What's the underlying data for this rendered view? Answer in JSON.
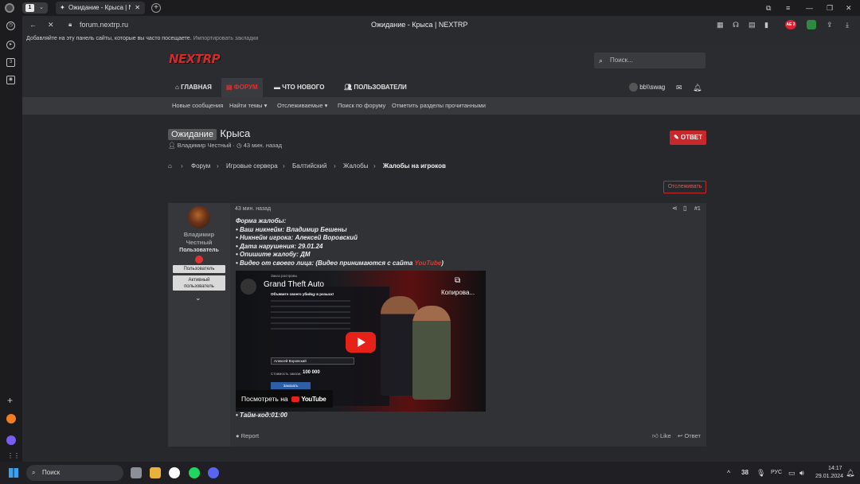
{
  "browser": {
    "tab_count": "1",
    "tab_title": "Ожидание - Крыса | NEXTRP",
    "address": "forum.nextrp.ru",
    "window_title": "Ожидание - Крыса | NEXTRP",
    "bookmarks_text": "Добавляйте на эту панель сайты, которые вы часто посещаете.",
    "bookmarks_link": "Импортировать закладки",
    "badge_ae": "AE 2"
  },
  "site": {
    "logo": "NEXTRP",
    "search_placeholder": "Поиск...",
    "nav": [
      {
        "label": "ГЛАВНАЯ"
      },
      {
        "label": "ФОРУМ"
      },
      {
        "label": "ЧТО НОВОГО"
      },
      {
        "label": "ПОЛЬЗОВАТЕЛИ"
      }
    ],
    "username": "bb\\\\swag",
    "subnav": [
      "Новые сообщения",
      "Найти темы",
      "Отслеживаемые",
      "Поиск по форуму",
      "Отметить разделы прочитанными"
    ]
  },
  "thread": {
    "prefix": "Ожидание",
    "title": "Крыса",
    "author": "Владимир Честный",
    "time": "43 мин. назад",
    "reply_button": "ОТВЕТ",
    "breadcrumbs": [
      "Форум",
      "Игровые сервера",
      "Балтийский",
      "Жалобы",
      "Жалобы на игроков"
    ],
    "watch_button": "Отслеживать"
  },
  "post": {
    "user_name": "Владимир Честный",
    "user_title": "Пользователь",
    "banner1": "Пользователь",
    "banner2": "Активный пользователь",
    "time": "43 мин. назад",
    "number": "#1",
    "lines": [
      "Форма жалобы:",
      "• Ваш никнейм: Владимир Бешены",
      "• Никнейм игрока: Алексей Воровский",
      "• Дата нарушения: 29.01.24",
      "• Опишите жалобу: ДМ"
    ],
    "video_line": "• Видео от своего лица: (Видео принимаются с сайта ",
    "video_link": "YouTube",
    "video_line_end": ")",
    "timecode": "• Тайм-код:01:00",
    "report": "Report",
    "like": "Like",
    "reply": "Ответ"
  },
  "video": {
    "title": "Grand Theft Auto",
    "copy": "Копирова...",
    "watch_on": "Посмотреть на",
    "youtube": "YouTube",
    "game_header": "Заказ расправы",
    "game_text1": "Объявите своего убийцу в розыск!",
    "game_name": "Алексей Воровский",
    "game_cost_label": "Стоимость заказа:",
    "game_cost": "100 000",
    "game_button": "Заказать"
  },
  "taskbar": {
    "search": "Поиск",
    "temp": "38",
    "lang": "РУС",
    "time": "14:17",
    "date": "29.01.2024"
  },
  "colors": {
    "accent": "#c6282b",
    "background": "#27282b"
  }
}
